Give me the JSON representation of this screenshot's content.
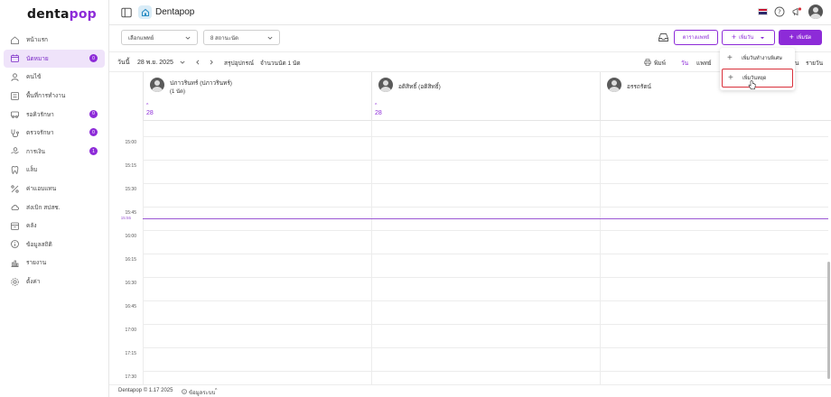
{
  "app": {
    "logo_main": "denta",
    "logo_accent": "pop",
    "brand_name": "Dentapop"
  },
  "sidebar": {
    "items": [
      {
        "label": "หน้าแรก",
        "icon": "home-icon",
        "active": false,
        "badge": ""
      },
      {
        "label": "นัดหมาย",
        "icon": "calendar-icon",
        "active": true,
        "badge": "0"
      },
      {
        "label": "คนไข้",
        "icon": "user-icon",
        "active": false,
        "badge": ""
      },
      {
        "label": "พื้นที่การทำงาน",
        "icon": "workspace-icon",
        "active": false,
        "badge": ""
      },
      {
        "label": "รอคิวรักษา",
        "icon": "waiting-icon",
        "active": false,
        "badge": "0"
      },
      {
        "label": "ตรวจรักษา",
        "icon": "treatment-icon",
        "active": false,
        "badge": "0"
      },
      {
        "label": "การเงิน",
        "icon": "finance-icon",
        "active": false,
        "badge": "1"
      },
      {
        "label": "แล็บ",
        "icon": "tooth-icon",
        "active": false,
        "badge": ""
      },
      {
        "label": "ค่าแอบแทน",
        "icon": "percent-icon",
        "active": false,
        "badge": ""
      },
      {
        "label": "ส่งเบิก สปสช.",
        "icon": "cloud-icon",
        "active": false,
        "badge": ""
      },
      {
        "label": "คลัง",
        "icon": "inventory-icon",
        "active": false,
        "badge": ""
      },
      {
        "label": "ข้อมูลสถิติ",
        "icon": "info-icon",
        "active": false,
        "badge": ""
      },
      {
        "label": "รายงาน",
        "icon": "report-icon",
        "active": false,
        "badge": ""
      },
      {
        "label": "ตั้งค่า",
        "icon": "gear-icon",
        "active": false,
        "badge": ""
      }
    ]
  },
  "filters": {
    "doctor_placeholder": "เลือกแพทย์",
    "status_value": "8 สถานะนัด",
    "doctor_schedule_button": "ตารางแพทย์",
    "add_day_button": "เพิ่มวัน",
    "add_appointment_button": "เพิ่มนัด"
  },
  "datebar": {
    "today": "วันนี้",
    "date": "28 พ.ย. 2025",
    "summary": "สรุปอุปกรณ์",
    "count": "จำนวนนัด 1 นัด",
    "print": "พิมพ์",
    "view_day": "วัน",
    "view_doctor": "แพทย์",
    "view_list_cut": "น",
    "view_list": "รายวัน"
  },
  "dropdown": {
    "items": [
      {
        "label": "เพิ่มวันทำงานพิเศษ"
      },
      {
        "label": "เพิ่มวันหยุด"
      }
    ]
  },
  "calendar": {
    "columns": [
      {
        "name": "ปภาวรินทร์ (ปภาวรินทร์)",
        "sub": "(1 นัด)",
        "day": "28"
      },
      {
        "name": "อติสิทธิ์ (อติสิทธิ์)",
        "sub": "",
        "day": "28"
      },
      {
        "name": "อรรถรัตน์",
        "sub": "",
        "day": ""
      }
    ],
    "times": [
      "15:00",
      "15:15",
      "15:30",
      "15:45",
      "16:00",
      "16:15",
      "16:30",
      "16:45",
      "17:00",
      "17:15",
      "17:30"
    ],
    "now_label": "15:55"
  },
  "footer": {
    "copyright": "Dentapop © 1.17 2025",
    "info": "ข้อมูลระบบ"
  },
  "colors": {
    "accent": "#8d2bd8",
    "now_line": "#9b57d3",
    "highlight": "#d9303b"
  }
}
